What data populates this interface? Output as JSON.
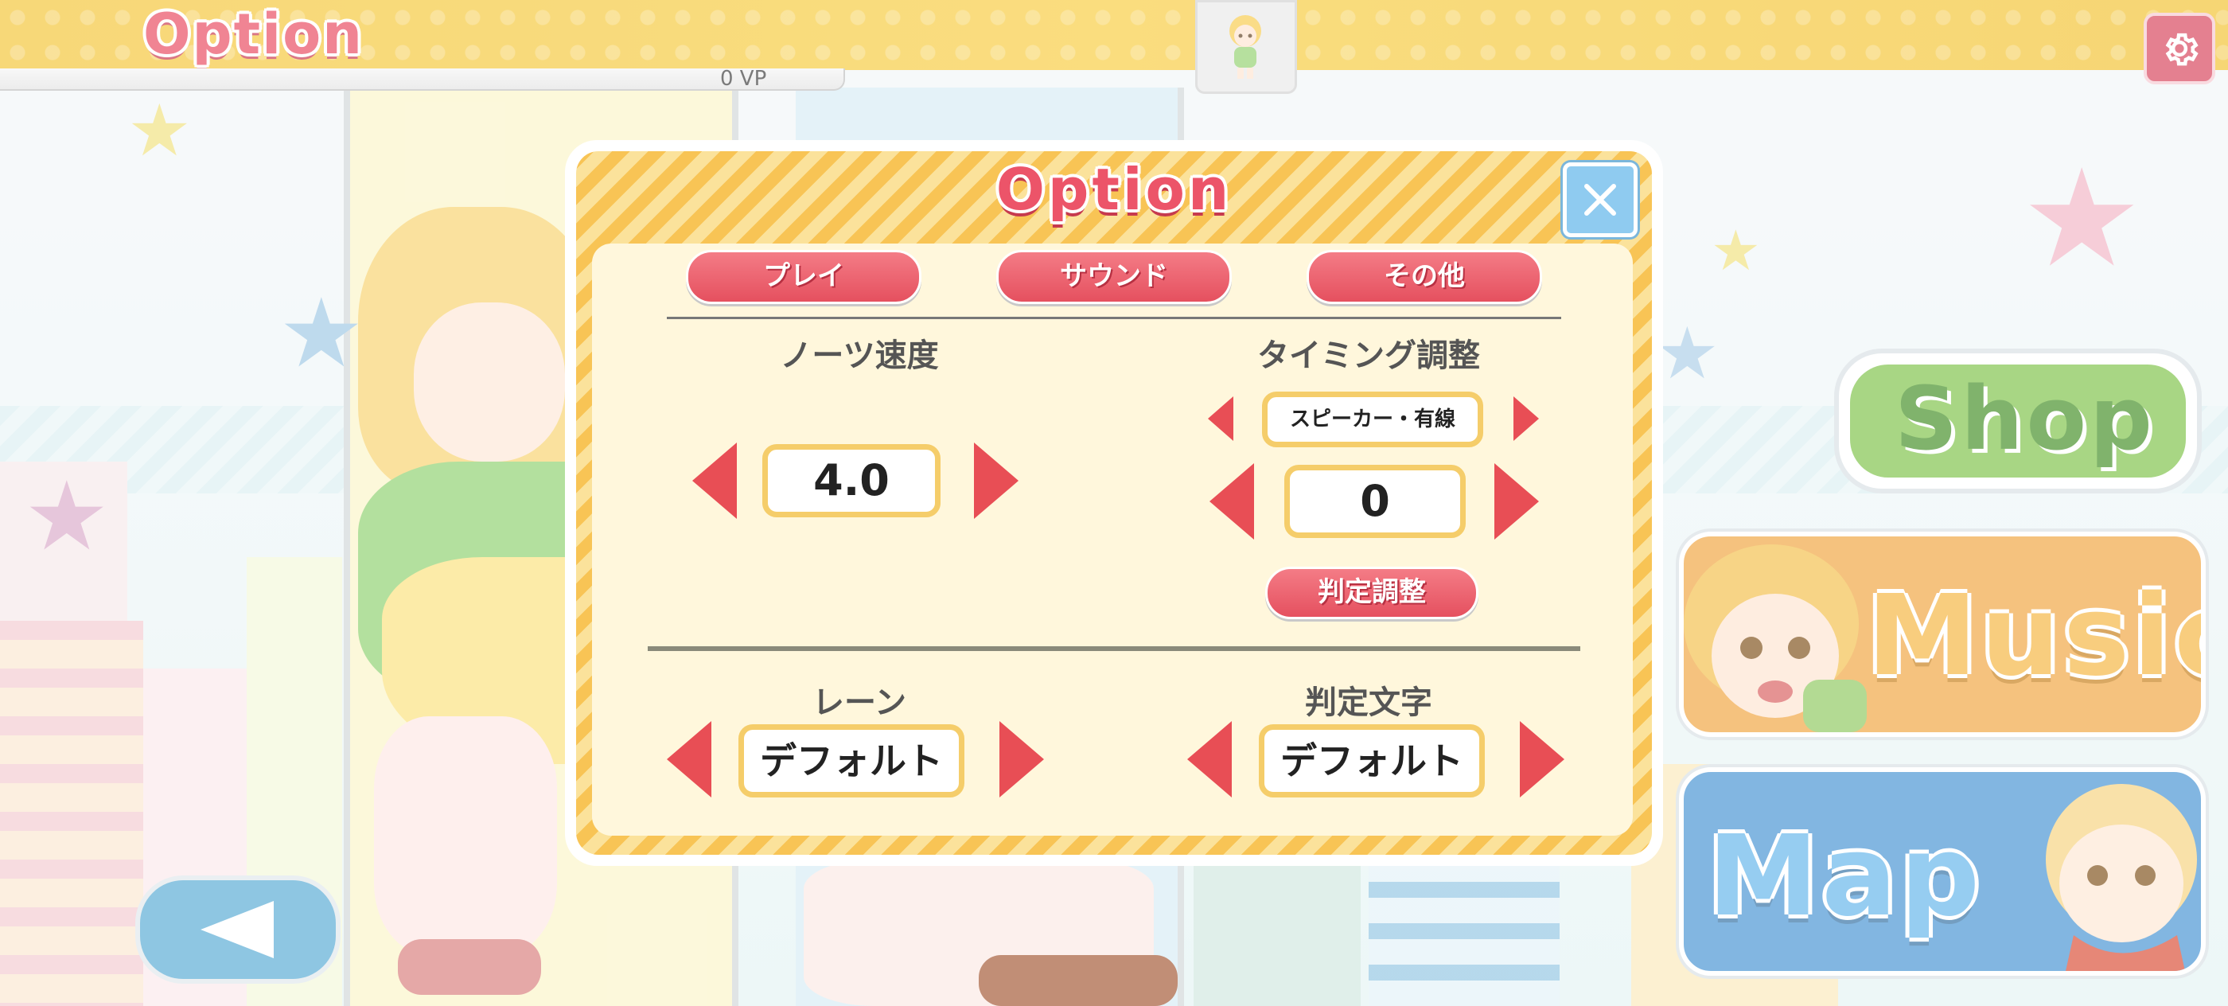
{
  "topbar": {
    "title": "Option",
    "vp": "0 VP"
  },
  "menu": {
    "shop": "Shop",
    "music": "Music",
    "map": "Map"
  },
  "dialog": {
    "title": "Option",
    "tabs": [
      "プレイ",
      "サウンド",
      "その他"
    ],
    "note_speed": {
      "label": "ノーツ速度",
      "value": "4.0"
    },
    "timing": {
      "label": "タイミング調整",
      "device": "スピーカー・有線",
      "value": "0",
      "judge_button": "判定調整"
    },
    "lane": {
      "label": "レーン",
      "value": "デフォルト"
    },
    "judge_text": {
      "label": "判定文字",
      "value": "デフォルト"
    }
  },
  "colors": {
    "accent_red": "#e84e55",
    "panel_yellow": "#f8c455",
    "topbar_yellow": "#f3c331",
    "close_blue": "#8fcbf0"
  },
  "icons": [
    "gear-icon",
    "close-icon",
    "back-arrow-icon",
    "character-avatar"
  ]
}
